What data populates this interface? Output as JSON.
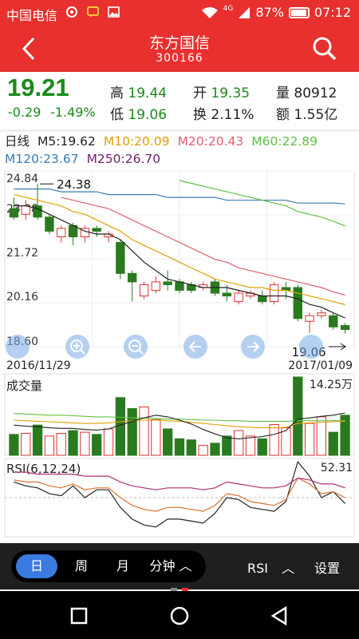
{
  "status": {
    "carrier": "中国电信",
    "network": "4G",
    "battery": "87%",
    "time": "07:12"
  },
  "header": {
    "name": "东方国信",
    "code": "300166"
  },
  "quote": {
    "price": "19.21",
    "change": "-0.29",
    "change_pct": "-1.49%",
    "high_label": "高",
    "high": "19.44",
    "low_label": "低",
    "low": "19.06",
    "open_label": "开",
    "open": "19.35",
    "turnover_label": "换",
    "turnover": "2.11%",
    "volume_label": "量",
    "volume": "80912",
    "amount_label": "额",
    "amount": "1.55亿"
  },
  "ma": {
    "label": "日线",
    "m5": "M5:19.62",
    "m10": "M10:20.09",
    "m20": "M20:20.43",
    "m60": "M60:22.89",
    "m120": "M120:23.67",
    "m250": "M250:26.70",
    "colors": {
      "m5": "#222222",
      "m10": "#e0a000",
      "m20": "#e06070",
      "m60": "#60c040",
      "m120": "#3a7ab0",
      "m250": "#702070"
    }
  },
  "colors": {
    "up": "#e03030",
    "down": "#2a7a20",
    "accent": "#e8302f"
  },
  "chart_data": [
    {
      "type": "candlestick",
      "ytick_labels": [
        "24.84",
        "23.28",
        "21.72",
        "20.16",
        "18.60"
      ],
      "ylim": [
        18.6,
        24.84
      ],
      "max_label": "24.38",
      "min_label": "19.06",
      "date_start": "2016/11/29",
      "date_end": "2017/01/09",
      "candles": [
        {
          "o": 23.5,
          "c": 23.2,
          "h": 23.9,
          "l": 23.1
        },
        {
          "o": 23.3,
          "c": 23.6,
          "h": 23.8,
          "l": 23.1
        },
        {
          "o": 23.6,
          "c": 23.2,
          "h": 24.38,
          "l": 23.1
        },
        {
          "o": 23.2,
          "c": 22.7,
          "h": 23.3,
          "l": 22.6
        },
        {
          "o": 22.5,
          "c": 22.8,
          "h": 22.9,
          "l": 22.3
        },
        {
          "o": 22.9,
          "c": 22.5,
          "h": 23.0,
          "l": 22.2
        },
        {
          "o": 22.5,
          "c": 22.8,
          "h": 22.9,
          "l": 22.3
        },
        {
          "o": 22.8,
          "c": 22.7,
          "h": 22.9,
          "l": 22.5
        },
        {
          "o": 22.5,
          "c": 22.6,
          "h": 22.7,
          "l": 22.3
        },
        {
          "o": 22.3,
          "c": 21.2,
          "h": 22.4,
          "l": 21.0
        },
        {
          "o": 21.2,
          "c": 20.9,
          "h": 21.3,
          "l": 20.2
        },
        {
          "o": 20.4,
          "c": 20.8,
          "h": 20.9,
          "l": 20.3
        },
        {
          "o": 20.6,
          "c": 20.9,
          "h": 21.1,
          "l": 20.5
        },
        {
          "o": 20.9,
          "c": 20.8,
          "h": 21.3,
          "l": 20.6
        },
        {
          "o": 20.9,
          "c": 20.6,
          "h": 21.0,
          "l": 20.5
        },
        {
          "o": 20.8,
          "c": 20.6,
          "h": 20.9,
          "l": 20.5
        },
        {
          "o": 20.7,
          "c": 20.8,
          "h": 20.9,
          "l": 20.6
        },
        {
          "o": 20.9,
          "c": 20.5,
          "h": 21.0,
          "l": 20.4
        },
        {
          "o": 20.5,
          "c": 20.4,
          "h": 20.8,
          "l": 20.2
        },
        {
          "o": 20.2,
          "c": 20.5,
          "h": 20.6,
          "l": 20.1
        },
        {
          "o": 20.4,
          "c": 20.5,
          "h": 20.6,
          "l": 20.3
        },
        {
          "o": 20.4,
          "c": 20.2,
          "h": 20.6,
          "l": 20.1
        },
        {
          "o": 20.2,
          "c": 20.8,
          "h": 20.9,
          "l": 20.1
        },
        {
          "o": 20.7,
          "c": 20.6,
          "h": 20.9,
          "l": 20.3
        },
        {
          "o": 20.7,
          "c": 19.6,
          "h": 20.8,
          "l": 19.5
        },
        {
          "o": 19.5,
          "c": 19.7,
          "h": 19.8,
          "l": 19.1
        },
        {
          "o": 19.7,
          "c": 19.8,
          "h": 19.9,
          "l": 19.6
        },
        {
          "o": 19.7,
          "c": 19.3,
          "h": 19.8,
          "l": 19.2
        },
        {
          "o": 19.35,
          "c": 19.21,
          "h": 19.44,
          "l": 19.06
        }
      ],
      "ma_lines": {
        "m5": [
          23.6,
          23.6,
          23.5,
          23.3,
          23.1,
          22.9,
          22.7,
          22.6,
          22.6,
          22.4,
          22.0,
          21.6,
          21.3,
          21.0,
          20.9,
          20.8,
          20.7,
          20.7,
          20.7,
          20.6,
          20.5,
          20.4,
          20.4,
          20.4,
          20.3,
          20.1,
          20.0,
          19.8,
          19.62
        ],
        "m10": [
          24.0,
          23.9,
          23.8,
          23.7,
          23.6,
          23.4,
          23.3,
          23.1,
          22.9,
          22.7,
          22.4,
          22.2,
          22.0,
          21.8,
          21.6,
          21.4,
          21.2,
          21.0,
          20.9,
          20.8,
          20.7,
          20.7,
          20.6,
          20.6,
          20.5,
          20.4,
          20.3,
          20.2,
          20.09
        ],
        "m20": [
          null,
          null,
          null,
          null,
          23.9,
          23.8,
          23.7,
          23.6,
          23.5,
          23.3,
          23.1,
          22.9,
          22.7,
          22.5,
          22.3,
          22.1,
          21.9,
          21.7,
          21.6,
          21.4,
          21.3,
          21.2,
          21.1,
          21.0,
          20.9,
          20.8,
          20.7,
          20.55,
          20.43
        ],
        "m60": [
          null,
          null,
          null,
          null,
          null,
          null,
          null,
          null,
          null,
          null,
          null,
          null,
          null,
          null,
          24.5,
          24.4,
          24.3,
          24.2,
          24.1,
          24.0,
          23.9,
          23.8,
          23.7,
          23.6,
          23.4,
          23.3,
          23.2,
          23.05,
          22.89
        ],
        "m120": [
          24.2,
          24.2,
          24.2,
          24.2,
          24.1,
          24.1,
          24.1,
          24.1,
          24.0,
          24.0,
          24.0,
          24.0,
          24.0,
          23.9,
          23.9,
          23.9,
          23.9,
          23.9,
          23.8,
          23.8,
          23.8,
          23.8,
          23.8,
          23.8,
          23.7,
          23.7,
          23.7,
          23.7,
          23.67
        ]
      }
    },
    {
      "type": "bar",
      "title": "成交量",
      "max_label": "14.25万",
      "ylim": [
        0,
        14.25
      ],
      "values": [
        3.8,
        4.0,
        5.5,
        3.5,
        4.0,
        4.5,
        4.2,
        3.8,
        4.8,
        10.5,
        8.5,
        8.8,
        6.5,
        4.8,
        3.0,
        2.8,
        1.8,
        2.2,
        3.5,
        4.5,
        3.5,
        3.0,
        5.6,
        5.0,
        14.25,
        5.8,
        7.0,
        4.2,
        7.3
      ],
      "up": [
        false,
        true,
        false,
        true,
        true,
        false,
        true,
        false,
        true,
        false,
        false,
        true,
        true,
        false,
        false,
        false,
        true,
        false,
        false,
        true,
        true,
        false,
        true,
        true,
        false,
        true,
        true,
        false,
        false
      ],
      "ma_lines": {
        "a": [
          5.5,
          5.3,
          5.2,
          5.0,
          4.9,
          4.9,
          4.7,
          4.6,
          4.8,
          5.5,
          6.2,
          6.8,
          7.3,
          7.0,
          6.4,
          5.7,
          4.7,
          3.9,
          3.2,
          3.0,
          3.2,
          3.4,
          3.8,
          4.5,
          6.6,
          6.8,
          7.1,
          7.3,
          7.7
        ],
        "b": [
          6.4,
          6.3,
          6.2,
          6.1,
          6.0,
          5.9,
          5.8,
          5.8,
          5.9,
          6.1,
          6.3,
          6.4,
          6.4,
          6.3,
          6.2,
          6.0,
          5.8,
          5.6,
          5.4,
          5.2,
          5.1,
          5.0,
          5.0,
          5.1,
          5.8,
          5.9,
          6.0,
          6.1,
          6.2
        ],
        "c": [
          7.6,
          7.5,
          7.4,
          7.3,
          7.3,
          7.2,
          7.1,
          7.0,
          7.0,
          6.9,
          6.8,
          6.8,
          6.7,
          6.6,
          6.6,
          6.5,
          6.4,
          6.4,
          6.3,
          6.3,
          6.2,
          6.2,
          6.2,
          6.2,
          6.3,
          6.3,
          6.3,
          6.3,
          6.3
        ]
      }
    },
    {
      "type": "line",
      "title": "RSI(6,12,24)",
      "max_label": "52.31",
      "ylim": [
        14,
        54
      ],
      "series": [
        {
          "values": [
            42,
            40,
            39,
            36,
            35,
            40,
            34,
            38,
            38,
            29,
            23,
            20,
            19,
            23,
            23,
            22,
            21,
            26,
            34,
            33,
            29,
            28,
            27,
            32,
            52.31,
            45,
            34,
            37,
            31
          ]
        },
        {
          "values": [
            43,
            42,
            42,
            40,
            39,
            41,
            38,
            39,
            39,
            34,
            30,
            28,
            27,
            29,
            29,
            28,
            27,
            30,
            36,
            35,
            32,
            31,
            30,
            33,
            44,
            41,
            36,
            37,
            34
          ]
        },
        {
          "values": [
            47,
            47,
            46,
            46,
            46,
            46,
            45,
            45,
            45,
            42,
            40,
            39,
            38,
            39,
            39,
            39,
            38,
            39,
            42,
            41,
            40,
            39,
            39,
            40,
            44,
            43,
            41,
            41,
            39
          ]
        }
      ]
    }
  ],
  "chart_controls": {
    "zoom_in": "zoom-in",
    "zoom_out": "zoom-out",
    "prev": "prev",
    "next": "next"
  },
  "bottom": {
    "tabs": [
      "日",
      "周",
      "月",
      "分钟"
    ],
    "indicator": "RSI",
    "settings": "设置"
  }
}
